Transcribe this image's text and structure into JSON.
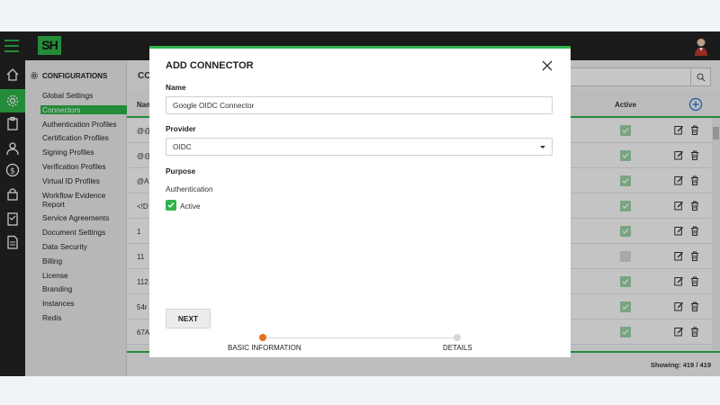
{
  "app": {
    "logo_text": "SH",
    "brand_color": "#2fb34a"
  },
  "rail": {
    "icons": [
      "home-icon",
      "settings-icon",
      "clipboard-icon",
      "user-group-icon",
      "dollar-icon",
      "lock-icon",
      "checklist-icon",
      "document-icon"
    ]
  },
  "sidebar": {
    "title": "CONFIGURATIONS",
    "items": [
      {
        "label": "Global Settings"
      },
      {
        "label": "Connectors",
        "active": true
      },
      {
        "label": "Authentication Profiles"
      },
      {
        "label": "Certification Profiles"
      },
      {
        "label": "Signing Profiles"
      },
      {
        "label": "Verification Profiles"
      },
      {
        "label": "Virtual ID Profiles"
      },
      {
        "label": "Workflow Evidence"
      },
      {
        "label": "Report"
      },
      {
        "label": "Service Agreements"
      },
      {
        "label": "Document Settings"
      },
      {
        "label": "Data Security"
      },
      {
        "label": "Billing"
      },
      {
        "label": "License"
      },
      {
        "label": "Branding"
      },
      {
        "label": "Instances"
      },
      {
        "label": "Redis"
      }
    ]
  },
  "main": {
    "title": "CO",
    "columns": {
      "name": "Nam",
      "active": "Active"
    },
    "rows": [
      {
        "name": "@@",
        "active": true
      },
      {
        "name": "@@",
        "active": true
      },
      {
        "name": "@A",
        "active": true
      },
      {
        "name": "<!D",
        "active": true
      },
      {
        "name": "1",
        "active": true
      },
      {
        "name": "11 ",
        "active": false
      },
      {
        "name": "112",
        "active": true
      },
      {
        "name": "54r",
        "active": true
      },
      {
        "name": "67A",
        "active": true
      }
    ],
    "showing": "Showing: 419 / 419"
  },
  "modal": {
    "title": "ADD CONNECTOR",
    "name_label": "Name",
    "name_value": "Google OIDC Connector",
    "provider_label": "Provider",
    "provider_value": "OIDC",
    "purpose_label": "Purpose",
    "purpose_value": "Authentication",
    "active_label": "Active",
    "next_label": "NEXT",
    "steps": [
      {
        "label": "BASIC INFORMATION",
        "state": "current",
        "color": "#e8701d"
      },
      {
        "label": "DETAILS",
        "state": "pending",
        "color": "#d6d6d6"
      }
    ]
  }
}
